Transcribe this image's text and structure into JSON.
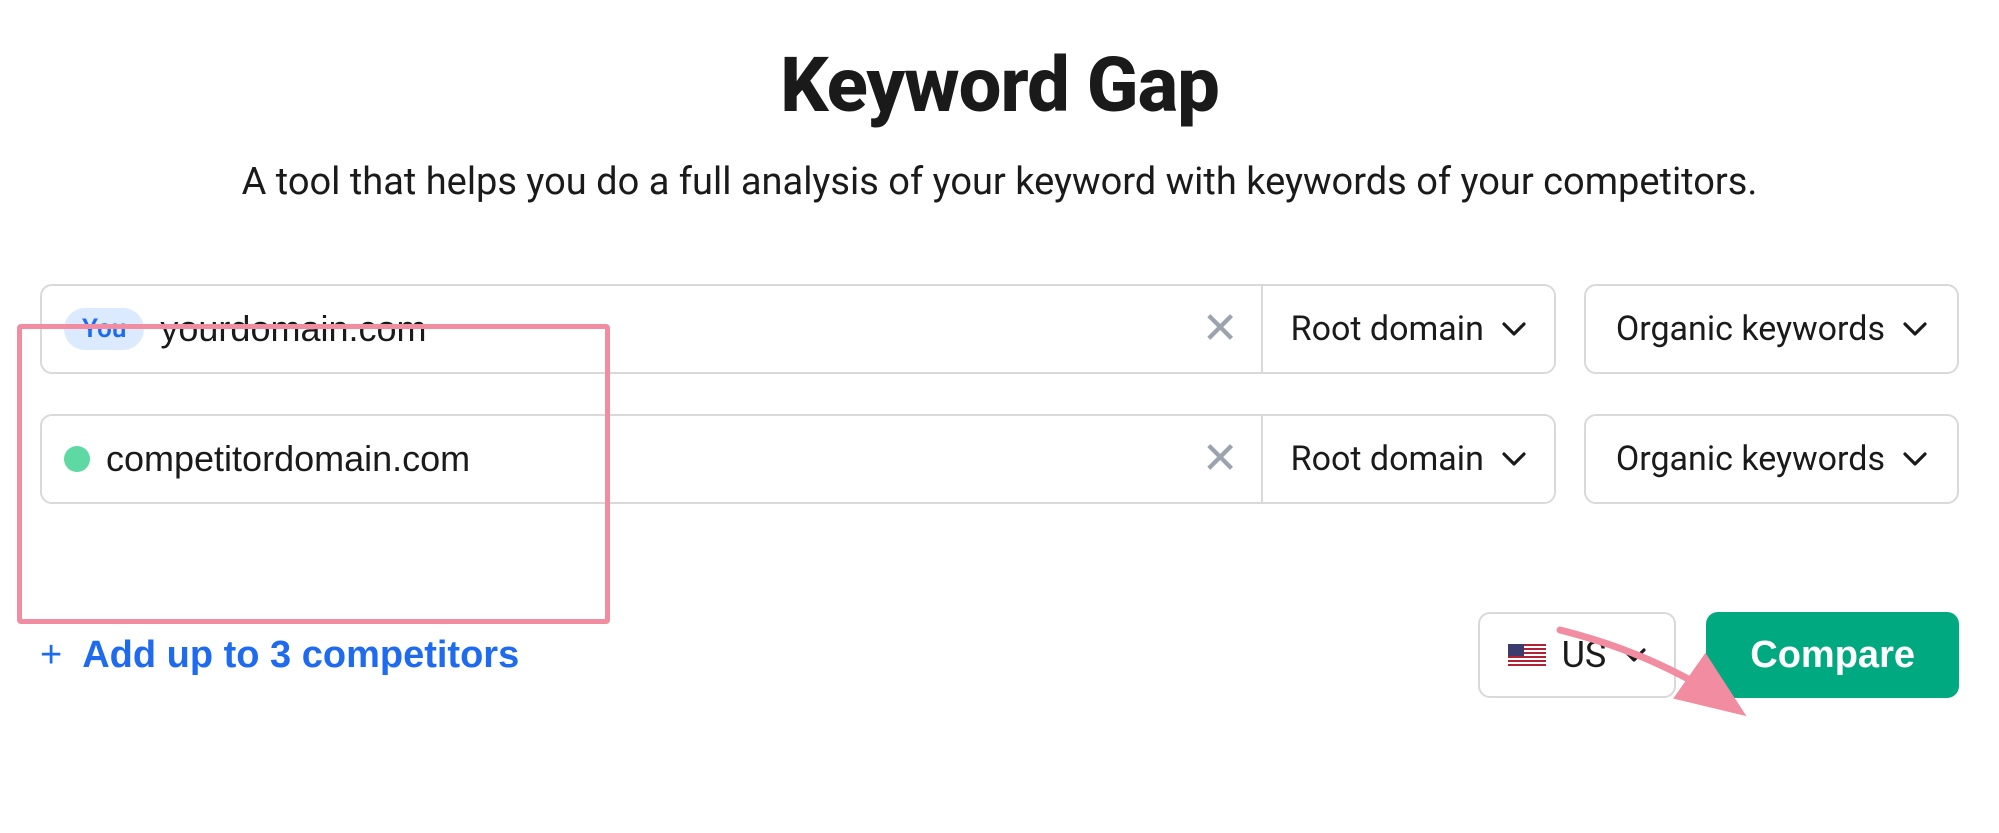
{
  "header": {
    "title": "Keyword Gap",
    "subtitle": "A tool that helps you do a full analysis of your keyword with keywords of your competitors."
  },
  "rows": [
    {
      "badge": "You",
      "domain": "yourdomain.com",
      "scope": "Root domain",
      "keyword_type": "Organic keywords"
    },
    {
      "domain": "competitordomain.com",
      "scope": "Root domain",
      "keyword_type": "Organic keywords"
    }
  ],
  "add_competitors_label": "Add up to 3 competitors",
  "country": {
    "label": "US"
  },
  "compare_label": "Compare",
  "colors": {
    "accent_blue": "#1e6bf0",
    "accent_green": "#00a97f",
    "highlight_pink": "#f28ca0",
    "dot_green": "#5fd9a3"
  }
}
